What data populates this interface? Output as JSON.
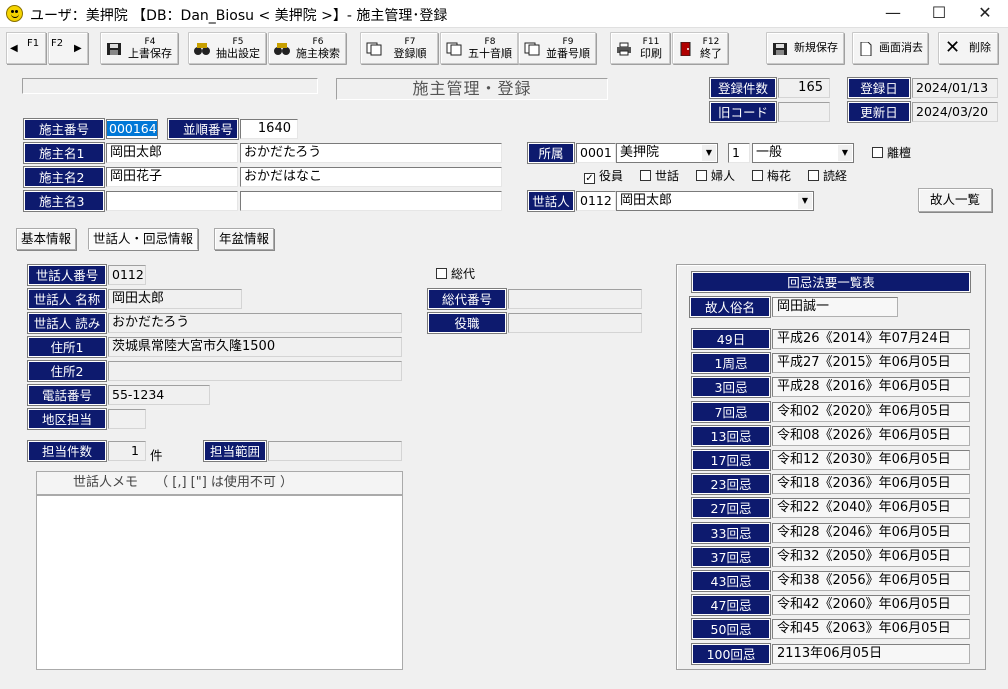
{
  "window": {
    "title": "ユーザ：美押院 【DB：Dan_Biosu < 美押院 >】- 施主管理･登録",
    "min": "—",
    "max": "☐",
    "close": "✕"
  },
  "toolbar": {
    "f1": "F1",
    "f2": "F2",
    "buttons": [
      {
        "key": "F4",
        "label": "上書保存"
      },
      {
        "key": "F5",
        "label": "抽出設定"
      },
      {
        "key": "F6",
        "label": "施主検索"
      },
      {
        "key": "F7",
        "label": "登録順"
      },
      {
        "key": "F8",
        "label": "五十音順"
      },
      {
        "key": "F9",
        "label": "並番号順"
      },
      {
        "key": "F11",
        "label": "印刷"
      },
      {
        "key": "F12",
        "label": "終了"
      }
    ],
    "new_save": "新規保存",
    "clear_screen": "画面消去",
    "delete": "削除"
  },
  "header": {
    "form_title": "施主管理・登録",
    "reg_count_label": "登録件数",
    "reg_count": "165",
    "old_code_label": "旧コード",
    "old_code": "",
    "reg_date_label": "登録日",
    "reg_date": "2024/01/13",
    "upd_date_label": "更新日",
    "upd_date": "2024/03/20"
  },
  "owner": {
    "no_label": "施主番号",
    "no": "000164",
    "order_label": "並順番号",
    "order": "1640",
    "name1_label": "施主名1",
    "name1": "岡田太郎",
    "kana1": "おかだたろう",
    "name2_label": "施主名2",
    "name2": "岡田花子",
    "kana2": "おかだはなこ",
    "name3_label": "施主名3",
    "name3": "",
    "kana3": "",
    "affil_label": "所属",
    "affil_code": "0001",
    "affil_name": "美押院",
    "class_code": "1",
    "class_name": "一般",
    "leave_label": "離檀",
    "roles": [
      "役員",
      "世話",
      "婦人",
      "梅花",
      "読経"
    ],
    "caretaker_label": "世話人",
    "caretaker_code": "0112",
    "caretaker_name": "岡田太郎",
    "deceased_list_btn": "故人一覧"
  },
  "tabs": [
    "基本情報",
    "世話人・回忌情報",
    "年盆情報"
  ],
  "care": {
    "no_label": "世話人番号",
    "no": "0112",
    "name_label": "世話人 名称",
    "name": "岡田太郎",
    "kana_label": "世話人 読み",
    "kana": "おかだたろう",
    "addr1_label": "住所1",
    "addr1": "茨城県常陸大宮市久隆1500",
    "addr2_label": "住所2",
    "addr2": "",
    "phone_label": "電話番号",
    "phone": "55-1234",
    "area_label": "地区担当",
    "area": "",
    "count_label": "担当件数",
    "count": "1",
    "count_unit": "件",
    "range_label": "担当範囲",
    "range": "",
    "sodai_label": "総代",
    "sodai_no_label": "総代番号",
    "sodai_no": "",
    "post_label": "役職",
    "post": "",
    "memo_header": "世話人メモ　 （ [,] [\"] は使用不可 ）",
    "memo": ""
  },
  "memorial": {
    "title": "回忌法要一覧表",
    "deceased_label": "故人俗名",
    "deceased_name": "岡田誠一",
    "rows": [
      {
        "label": "49日",
        "date": "平成26《2014》年07月24日"
      },
      {
        "label": "1周忌",
        "date": "平成27《2015》年06月05日"
      },
      {
        "label": "3回忌",
        "date": "平成28《2016》年06月05日"
      },
      {
        "label": "7回忌",
        "date": "令和02《2020》年06月05日"
      },
      {
        "label": "13回忌",
        "date": "令和08《2026》年06月05日"
      },
      {
        "label": "17回忌",
        "date": "令和12《2030》年06月05日"
      },
      {
        "label": "23回忌",
        "date": "令和18《2036》年06月05日"
      },
      {
        "label": "27回忌",
        "date": "令和22《2040》年06月05日"
      },
      {
        "label": "33回忌",
        "date": "令和28《2046》年06月05日"
      },
      {
        "label": "37回忌",
        "date": "令和32《2050》年06月05日"
      },
      {
        "label": "43回忌",
        "date": "令和38《2056》年06月05日"
      },
      {
        "label": "47回忌",
        "date": "令和42《2060》年06月05日"
      },
      {
        "label": "50回忌",
        "date": "令和45《2063》年06月05日"
      },
      {
        "label": "100回忌",
        "date": "2113年06月05日"
      }
    ]
  }
}
